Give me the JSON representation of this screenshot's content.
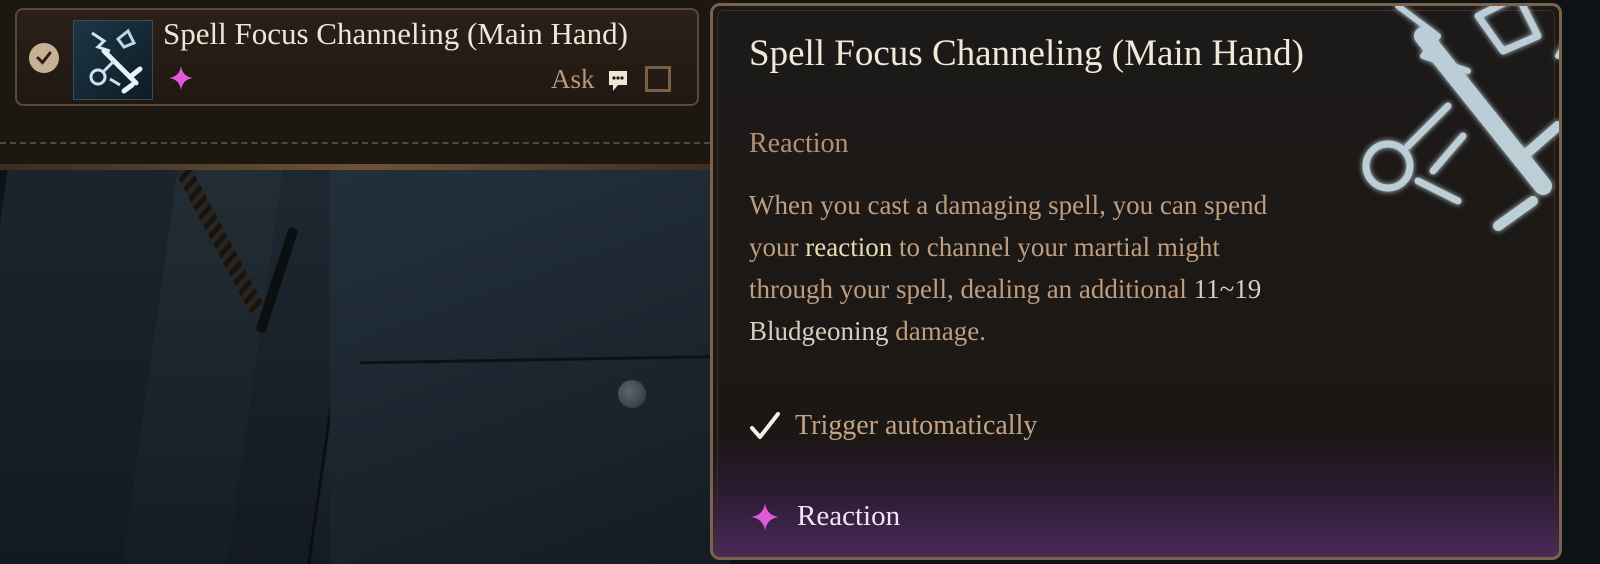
{
  "spell_row": {
    "name": "Spell Focus Channeling (Main Hand)",
    "ask_label": "Ask",
    "enabled": true,
    "icon": "sword-staff-icon",
    "cost_icon": "reaction-spark-icon"
  },
  "tooltip": {
    "title": "Spell Focus Channeling (Main Hand)",
    "type": "Reaction",
    "description": {
      "part1": "When you cast a damaging spell, you can spend your ",
      "highlight": "reaction",
      "part2": " to channel your martial might through your spell, dealing an additional ",
      "damage": "11~19 Bludgeoning",
      "part3": " damage."
    },
    "trigger_label": "Trigger automatically",
    "footer_label": "Reaction"
  },
  "colors": {
    "accent_gold": "#7c6246",
    "reaction_pink": "#e05bd8",
    "highlight": "#e8dcae"
  }
}
